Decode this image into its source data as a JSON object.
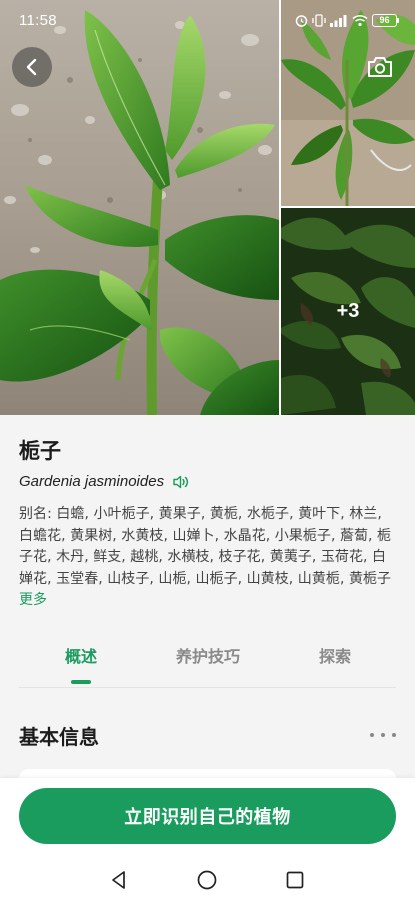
{
  "status_bar": {
    "time": "11:58",
    "battery": "96",
    "icons": [
      "alarm-icon",
      "vibrate-icon",
      "signal-icon",
      "wifi-icon",
      "battery-icon"
    ]
  },
  "gallery": {
    "more_count": "+3",
    "back_icon": "chevron-left-icon",
    "camera_icon": "camera-icon"
  },
  "plant": {
    "name": "栀子",
    "scientific_name": "Gardenia jasminoides",
    "aliases_label": "别名: ",
    "aliases": "白蟾, 小叶栀子, 黄果子, 黄栀, 水栀子, 黄叶下, 林兰, 白蟾花, 黄果树, 水黄枝, 山婵卜, 水晶花, 小果栀子, 薝蔔, 栀子花, 木丹, 鲜支, 越桃, 水横枝, 枝子花, 黄荑子, 玉荷花, 白婵花, 玉堂春, 山枝子, 山栀, 山栀子, 山黄枝, 山黄栀, 黄栀子",
    "more_label": "更多"
  },
  "tabs": [
    {
      "label": "概述",
      "active": true
    },
    {
      "label": "养护技巧",
      "active": false
    },
    {
      "label": "探索",
      "active": false
    }
  ],
  "section": {
    "title": "基本信息"
  },
  "bottom": {
    "identify_label": "立即识别自己的植物"
  },
  "colors": {
    "accent": "#1a9c5e",
    "background": "#f4f4f4"
  }
}
